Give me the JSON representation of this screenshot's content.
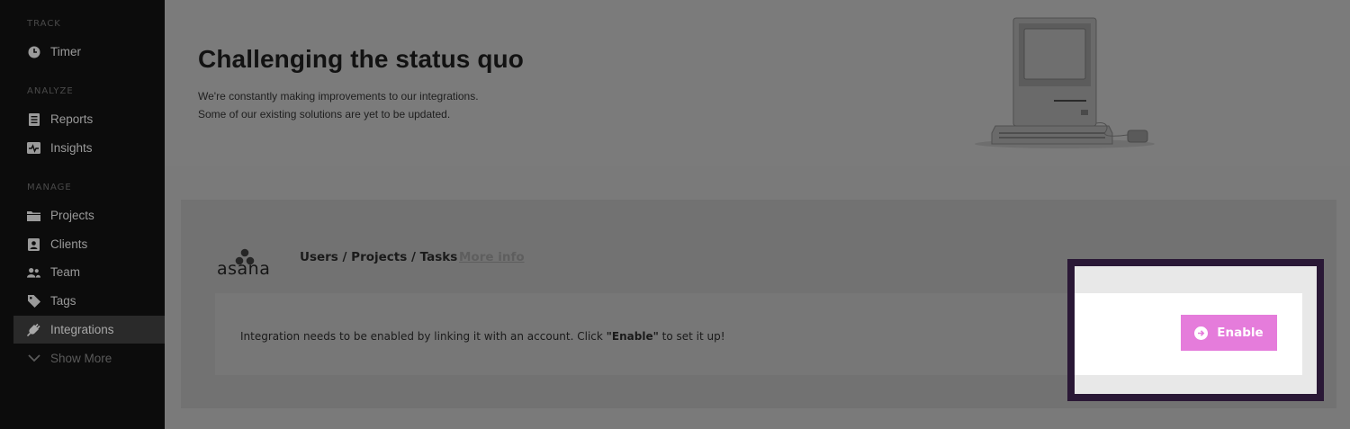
{
  "sidebar": {
    "sections": [
      {
        "label": "TRACK"
      },
      {
        "label": "ANALYZE"
      },
      {
        "label": "MANAGE"
      }
    ],
    "items": [
      {
        "label": "Timer",
        "icon": "clock-icon"
      },
      {
        "label": "Reports",
        "icon": "reports-icon"
      },
      {
        "label": "Insights",
        "icon": "insights-icon"
      },
      {
        "label": "Projects",
        "icon": "folder-icon"
      },
      {
        "label": "Clients",
        "icon": "client-icon"
      },
      {
        "label": "Team",
        "icon": "team-icon"
      },
      {
        "label": "Tags",
        "icon": "tag-icon"
      },
      {
        "label": "Integrations",
        "icon": "plug-icon",
        "active": true
      },
      {
        "label": "Show More",
        "icon": "chevron-down-icon"
      }
    ]
  },
  "hero": {
    "title": "Challenging the status quo",
    "line1": "We're constantly making improvements to our integrations.",
    "line2": "Some of our existing solutions are yet to be updated."
  },
  "integration": {
    "name": "asana",
    "type": "Users / Projects / Tasks",
    "more_info": "More info",
    "notice_pre": "Integration needs to be enabled by linking it with an account. Click ",
    "notice_bold": "\"Enable\"",
    "notice_post": " to set it up!",
    "enable_label": "Enable",
    "accent_color": "#e57cdb"
  }
}
